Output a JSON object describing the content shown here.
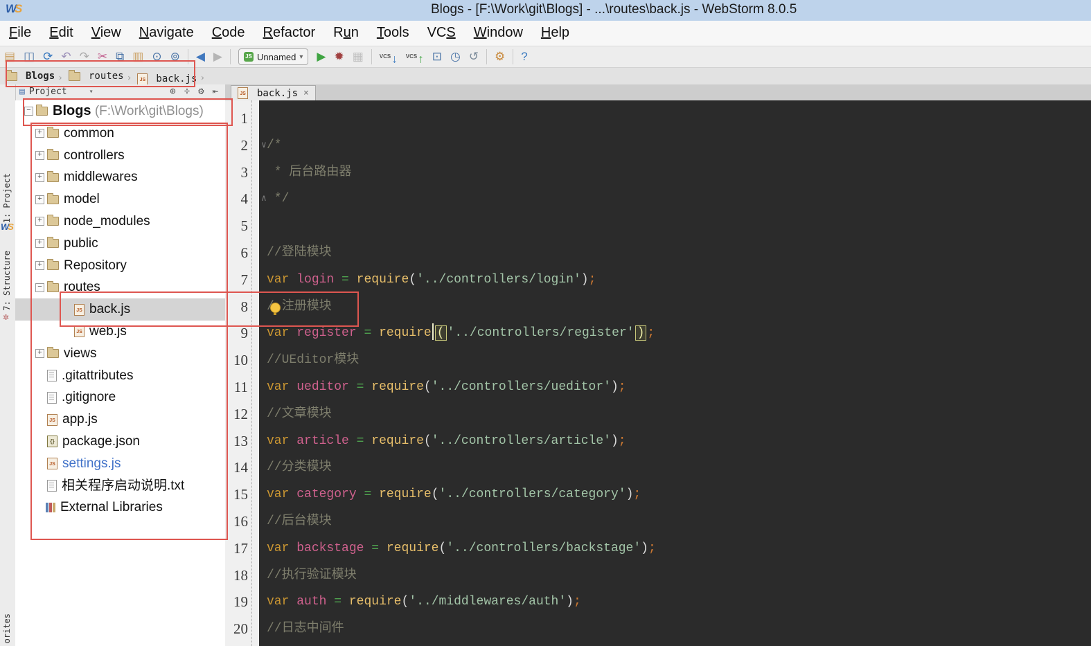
{
  "window": {
    "title": "Blogs - [F:\\Work\\git\\Blogs] - ...\\routes\\back.js - WebStorm 8.0.5",
    "logo_left": "W",
    "logo_right": "S"
  },
  "menu": {
    "items": [
      {
        "label": "File",
        "u": 0
      },
      {
        "label": "Edit",
        "u": 0
      },
      {
        "label": "View",
        "u": 0
      },
      {
        "label": "Navigate",
        "u": 0
      },
      {
        "label": "Code",
        "u": 0
      },
      {
        "label": "Refactor",
        "u": 0
      },
      {
        "label": "Run",
        "u": 1
      },
      {
        "label": "Tools",
        "u": 0
      },
      {
        "label": "VCS",
        "u": 2
      },
      {
        "label": "Window",
        "u": 0
      },
      {
        "label": "Help",
        "u": 0
      }
    ]
  },
  "toolbar": {
    "groups": [
      {
        "icons": [
          [
            "open-folder-icon",
            "▤",
            "#C89B5A"
          ],
          [
            "save-all-icon",
            "◫",
            "#4D76A8"
          ],
          [
            "sync-icon",
            "⟳",
            "#3A7ABF"
          ],
          [
            "undo-icon",
            "↶",
            "#9A8FB8"
          ],
          [
            "redo-icon",
            "↷",
            "#ABABAB"
          ],
          [
            "cut-icon",
            "✂",
            "#C05C8C"
          ],
          [
            "copy-icon",
            "⧉",
            "#4D76A8"
          ],
          [
            "paste-icon",
            "▥",
            "#C89B5A"
          ],
          [
            "find-icon",
            "⊙",
            "#4D76A8"
          ],
          [
            "replace-icon",
            "⊚",
            "#4D76A8"
          ]
        ]
      },
      {
        "icons": [
          [
            "back-icon",
            "◀",
            "#4178BE"
          ],
          [
            "forward-icon",
            "▶",
            "#B5B5B5"
          ]
        ]
      },
      {
        "combo": {
          "js_badge": "JS",
          "label": "Unnamed",
          "arrow": "▾"
        },
        "icons": [
          [
            "run-icon",
            "▶",
            "#3FA442"
          ],
          [
            "debug-icon",
            "✹",
            "#A04040"
          ],
          [
            "coverage-icon",
            "▦",
            "#C0C0C0"
          ]
        ]
      },
      {
        "icons": [
          [
            "vcs-update-icon",
            "↓",
            "#3A7ABF",
            "VCS"
          ],
          [
            "vcs-commit-icon",
            "↑",
            "#3FA442",
            "VCS"
          ],
          [
            "changes-icon",
            "⊡",
            "#4D76A8"
          ],
          [
            "history-icon",
            "◷",
            "#4D76A8"
          ],
          [
            "rollback-icon",
            "↺",
            "#7A8A99"
          ]
        ]
      },
      {
        "icons": [
          [
            "settings-wrench-icon",
            "⚙",
            "#C8883A"
          ]
        ]
      },
      {
        "icons": [
          [
            "help-icon",
            "?",
            "#3A7ABF"
          ]
        ]
      }
    ]
  },
  "breadcrumbs": {
    "separator": "›",
    "items": [
      {
        "label": "Blogs",
        "icon": "folder"
      },
      {
        "label": "routes",
        "icon": "folder"
      },
      {
        "label": "back.js",
        "icon": "js"
      }
    ]
  },
  "tool_window_bar": {
    "project_tab": "1: Project",
    "structure_tab": "7: Structure",
    "favorites_partial": "orites",
    "logo_left": "W",
    "logo_right": "S",
    "structure_glyph": "✲"
  },
  "project_panel": {
    "header": {
      "title": "Project",
      "panel_glyph": "▤",
      "dropdown_arrow": "▾",
      "icons": [
        {
          "name": "locate-icon",
          "glyph": "⊕"
        },
        {
          "name": "collapse-all-icon",
          "glyph": "÷"
        },
        {
          "name": "settings-gear-icon",
          "glyph": "⚙"
        },
        {
          "name": "hide-panel-icon",
          "glyph": "⇤"
        }
      ]
    },
    "tree": [
      {
        "label": "Blogs",
        "suffix": " (F:\\Work\\git\\Blogs)",
        "icon": "folder",
        "depth": "d0",
        "toggle": "minus",
        "root": true
      },
      {
        "label": "common",
        "icon": "folder",
        "depth": "d1",
        "toggle": "plus"
      },
      {
        "label": "controllers",
        "icon": "folder",
        "depth": "d1",
        "toggle": "plus"
      },
      {
        "label": "middlewares",
        "icon": "folder",
        "depth": "d1",
        "toggle": "plus"
      },
      {
        "label": "model",
        "icon": "folder",
        "depth": "d1",
        "toggle": "plus"
      },
      {
        "label": "node_modules",
        "icon": "folder",
        "depth": "d1",
        "toggle": "plus"
      },
      {
        "label": "public",
        "icon": "folder",
        "depth": "d1",
        "toggle": "plus"
      },
      {
        "label": "Repository",
        "icon": "folder",
        "depth": "d1",
        "toggle": "plus"
      },
      {
        "label": "routes",
        "icon": "folder",
        "depth": "d1",
        "toggle": "minus"
      },
      {
        "label": "back.js",
        "icon": "js",
        "depth": "d2",
        "selected": true
      },
      {
        "label": "web.js",
        "icon": "js",
        "depth": "d2"
      },
      {
        "label": "views",
        "icon": "folder",
        "depth": "d1",
        "toggle": "plus"
      },
      {
        "label": ".gitattributes",
        "icon": "file",
        "depth": "d1"
      },
      {
        "label": ".gitignore",
        "icon": "file",
        "depth": "d1"
      },
      {
        "label": "app.js",
        "icon": "js",
        "depth": "d1"
      },
      {
        "label": "package.json",
        "icon": "json",
        "depth": "d1"
      },
      {
        "label": "settings.js",
        "icon": "js",
        "depth": "d1",
        "color": "#4273C9"
      },
      {
        "label": "相关程序启动说明.txt",
        "icon": "file",
        "depth": "d1"
      },
      {
        "label": "External Libraries",
        "icon": "lib",
        "depth": "dx"
      }
    ]
  },
  "editor": {
    "tab": {
      "label": "back.js",
      "close_glyph": "×",
      "js_badge": "JS"
    },
    "lines": [
      {
        "n": 1,
        "segs": []
      },
      {
        "n": 2,
        "fold": "∨",
        "segs": [
          [
            "cm",
            "/*"
          ]
        ]
      },
      {
        "n": 3,
        "segs": [
          [
            "cm",
            " * 后台路由器"
          ]
        ]
      },
      {
        "n": 4,
        "fold": "∧",
        "segs": [
          [
            "cm",
            " */"
          ]
        ]
      },
      {
        "n": 5,
        "segs": []
      },
      {
        "n": 6,
        "segs": [
          [
            "cm",
            "//登陆模块"
          ]
        ]
      },
      {
        "n": 7,
        "segs": [
          [
            "kw",
            "var"
          ],
          [
            "pl",
            " "
          ],
          [
            "vr",
            "login"
          ],
          [
            "pl",
            " "
          ],
          [
            "op",
            "="
          ],
          [
            "pl",
            " "
          ],
          [
            "fn",
            "require"
          ],
          [
            "pr",
            "("
          ],
          [
            "st",
            "'../controllers/login'"
          ],
          [
            "pr",
            ")"
          ],
          [
            "sm",
            ";"
          ]
        ]
      },
      {
        "n": 8,
        "segs": [
          [
            "cm",
            "/"
          ],
          [
            "bulb",
            ""
          ],
          [
            "cm",
            "注册模块"
          ]
        ]
      },
      {
        "n": 9,
        "segs": [
          [
            "kw",
            "var"
          ],
          [
            "pl",
            " "
          ],
          [
            "vr",
            "register"
          ],
          [
            "pl",
            " "
          ],
          [
            "op",
            "="
          ],
          [
            "pl",
            " "
          ],
          [
            "fn",
            "require"
          ],
          [
            "caret",
            ""
          ],
          [
            "prm",
            "("
          ],
          [
            "st",
            "'../controllers/register'"
          ],
          [
            "prm",
            ")"
          ],
          [
            "sm",
            ";"
          ]
        ]
      },
      {
        "n": 10,
        "segs": [
          [
            "cm",
            "//UEditor模块"
          ]
        ]
      },
      {
        "n": 11,
        "segs": [
          [
            "kw",
            "var"
          ],
          [
            "pl",
            " "
          ],
          [
            "vr",
            "ueditor"
          ],
          [
            "pl",
            " "
          ],
          [
            "op",
            "="
          ],
          [
            "pl",
            " "
          ],
          [
            "fn",
            "require"
          ],
          [
            "pr",
            "("
          ],
          [
            "st",
            "'../controllers/ueditor'"
          ],
          [
            "pr",
            ")"
          ],
          [
            "sm",
            ";"
          ]
        ]
      },
      {
        "n": 12,
        "segs": [
          [
            "cm",
            "//文章模块"
          ]
        ]
      },
      {
        "n": 13,
        "segs": [
          [
            "kw",
            "var"
          ],
          [
            "pl",
            " "
          ],
          [
            "vr",
            "article"
          ],
          [
            "pl",
            " "
          ],
          [
            "op",
            "="
          ],
          [
            "pl",
            " "
          ],
          [
            "fn",
            "require"
          ],
          [
            "pr",
            "("
          ],
          [
            "st",
            "'../controllers/article'"
          ],
          [
            "pr",
            ")"
          ],
          [
            "sm",
            ";"
          ]
        ]
      },
      {
        "n": 14,
        "segs": [
          [
            "cm",
            "//分类模块"
          ]
        ]
      },
      {
        "n": 15,
        "segs": [
          [
            "kw",
            "var"
          ],
          [
            "pl",
            " "
          ],
          [
            "vr",
            "category"
          ],
          [
            "pl",
            " "
          ],
          [
            "op",
            "="
          ],
          [
            "pl",
            " "
          ],
          [
            "fn",
            "require"
          ],
          [
            "pr",
            "("
          ],
          [
            "st",
            "'../controllers/category'"
          ],
          [
            "pr",
            ")"
          ],
          [
            "sm",
            ";"
          ]
        ]
      },
      {
        "n": 16,
        "segs": [
          [
            "cm",
            "//后台模块"
          ]
        ]
      },
      {
        "n": 17,
        "segs": [
          [
            "kw",
            "var"
          ],
          [
            "pl",
            " "
          ],
          [
            "vr",
            "backstage"
          ],
          [
            "pl",
            " "
          ],
          [
            "op",
            "="
          ],
          [
            "pl",
            " "
          ],
          [
            "fn",
            "require"
          ],
          [
            "pr",
            "("
          ],
          [
            "st",
            "'../controllers/backstage'"
          ],
          [
            "pr",
            ")"
          ],
          [
            "sm",
            ";"
          ]
        ]
      },
      {
        "n": 18,
        "segs": [
          [
            "cm",
            "//执行验证模块"
          ]
        ]
      },
      {
        "n": 19,
        "segs": [
          [
            "kw",
            "var"
          ],
          [
            "pl",
            " "
          ],
          [
            "vr",
            "auth"
          ],
          [
            "pl",
            " "
          ],
          [
            "op",
            "="
          ],
          [
            "pl",
            " "
          ],
          [
            "fn",
            "require"
          ],
          [
            "pr",
            "("
          ],
          [
            "st",
            "'../middlewares/auth'"
          ],
          [
            "pr",
            ")"
          ],
          [
            "sm",
            ";"
          ]
        ]
      },
      {
        "n": 20,
        "segs": [
          [
            "cm",
            "//日志中间件"
          ]
        ]
      }
    ]
  },
  "annotation_color": "#DE5650"
}
